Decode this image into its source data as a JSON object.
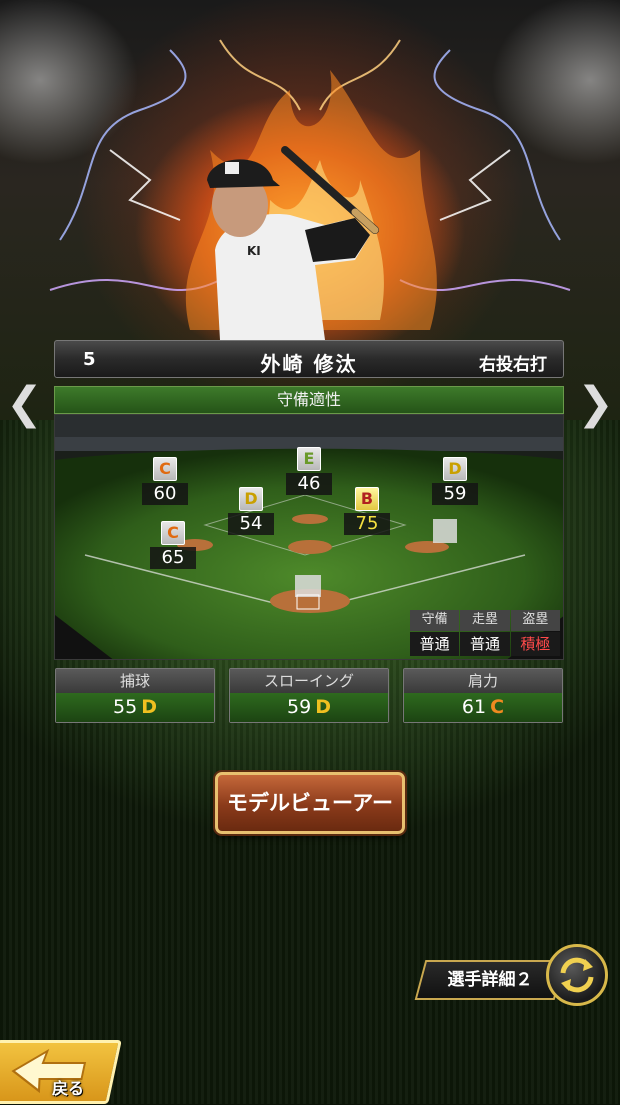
{
  "player": {
    "number": "5",
    "name": "外崎 修汰",
    "handedness": "右投右打"
  },
  "defense": {
    "title": "守備適性",
    "positions": [
      {
        "id": "lf",
        "grade": "C",
        "value": "60"
      },
      {
        "id": "cf",
        "grade": "E",
        "value": "46"
      },
      {
        "id": "rf",
        "grade": "D",
        "value": "59"
      },
      {
        "id": "ss",
        "grade": "D",
        "value": "54"
      },
      {
        "id": "2b",
        "grade": "B",
        "value": "75"
      },
      {
        "id": "3b",
        "grade": "C",
        "value": "65"
      }
    ],
    "traits": {
      "headers": [
        "守備",
        "走塁",
        "盗塁"
      ],
      "values": [
        "普通",
        "普通",
        "積極"
      ]
    }
  },
  "stats": [
    {
      "label": "捕球",
      "value": "55",
      "grade": "D"
    },
    {
      "label": "スローイング",
      "value": "59",
      "grade": "D"
    },
    {
      "label": "肩力",
      "value": "61",
      "grade": "C"
    }
  ],
  "buttons": {
    "model_viewer": "モデルビューアー",
    "player_detail": "選手詳細２",
    "back": "戻る"
  },
  "icons": {
    "prev": "chevron-left-icon",
    "next": "chevron-right-icon",
    "cycle": "cycle-arrows-icon",
    "back": "back-arrow-icon"
  },
  "colors": {
    "grade_b": "#f5e040",
    "grade_c": "#f08a20",
    "grade_d": "#f0c020",
    "trait_aggressive": "#ff4a4a",
    "panel_green": "#255418"
  }
}
